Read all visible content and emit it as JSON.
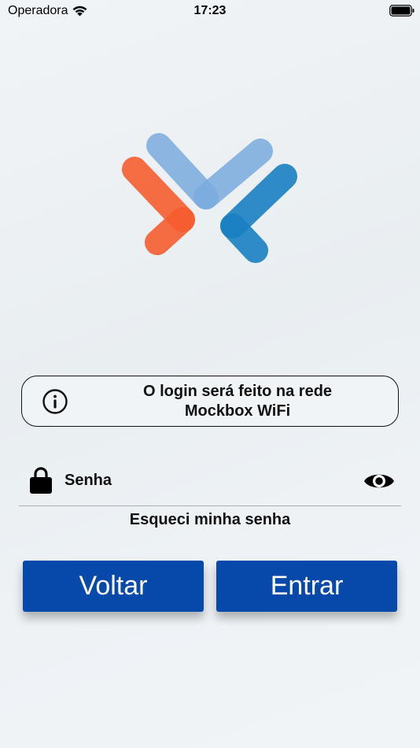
{
  "status_bar": {
    "carrier": "Operadora",
    "time": "17:23"
  },
  "info": {
    "line1": "O login será feito na rede",
    "line2": "Mockbox WiFi"
  },
  "password": {
    "placeholder": "Senha",
    "value": ""
  },
  "forgot_password": "Esqueci minha senha",
  "buttons": {
    "back": "Voltar",
    "enter": "Entrar"
  },
  "colors": {
    "primary": "#0748ab",
    "logo_orange": "#f65d30",
    "logo_light_blue": "#7aaadd",
    "logo_blue": "#1a80c2"
  },
  "icons": {
    "wifi": "wifi-icon",
    "battery": "battery-icon",
    "info": "info-icon",
    "lock": "lock-icon",
    "eye": "eye-icon"
  }
}
